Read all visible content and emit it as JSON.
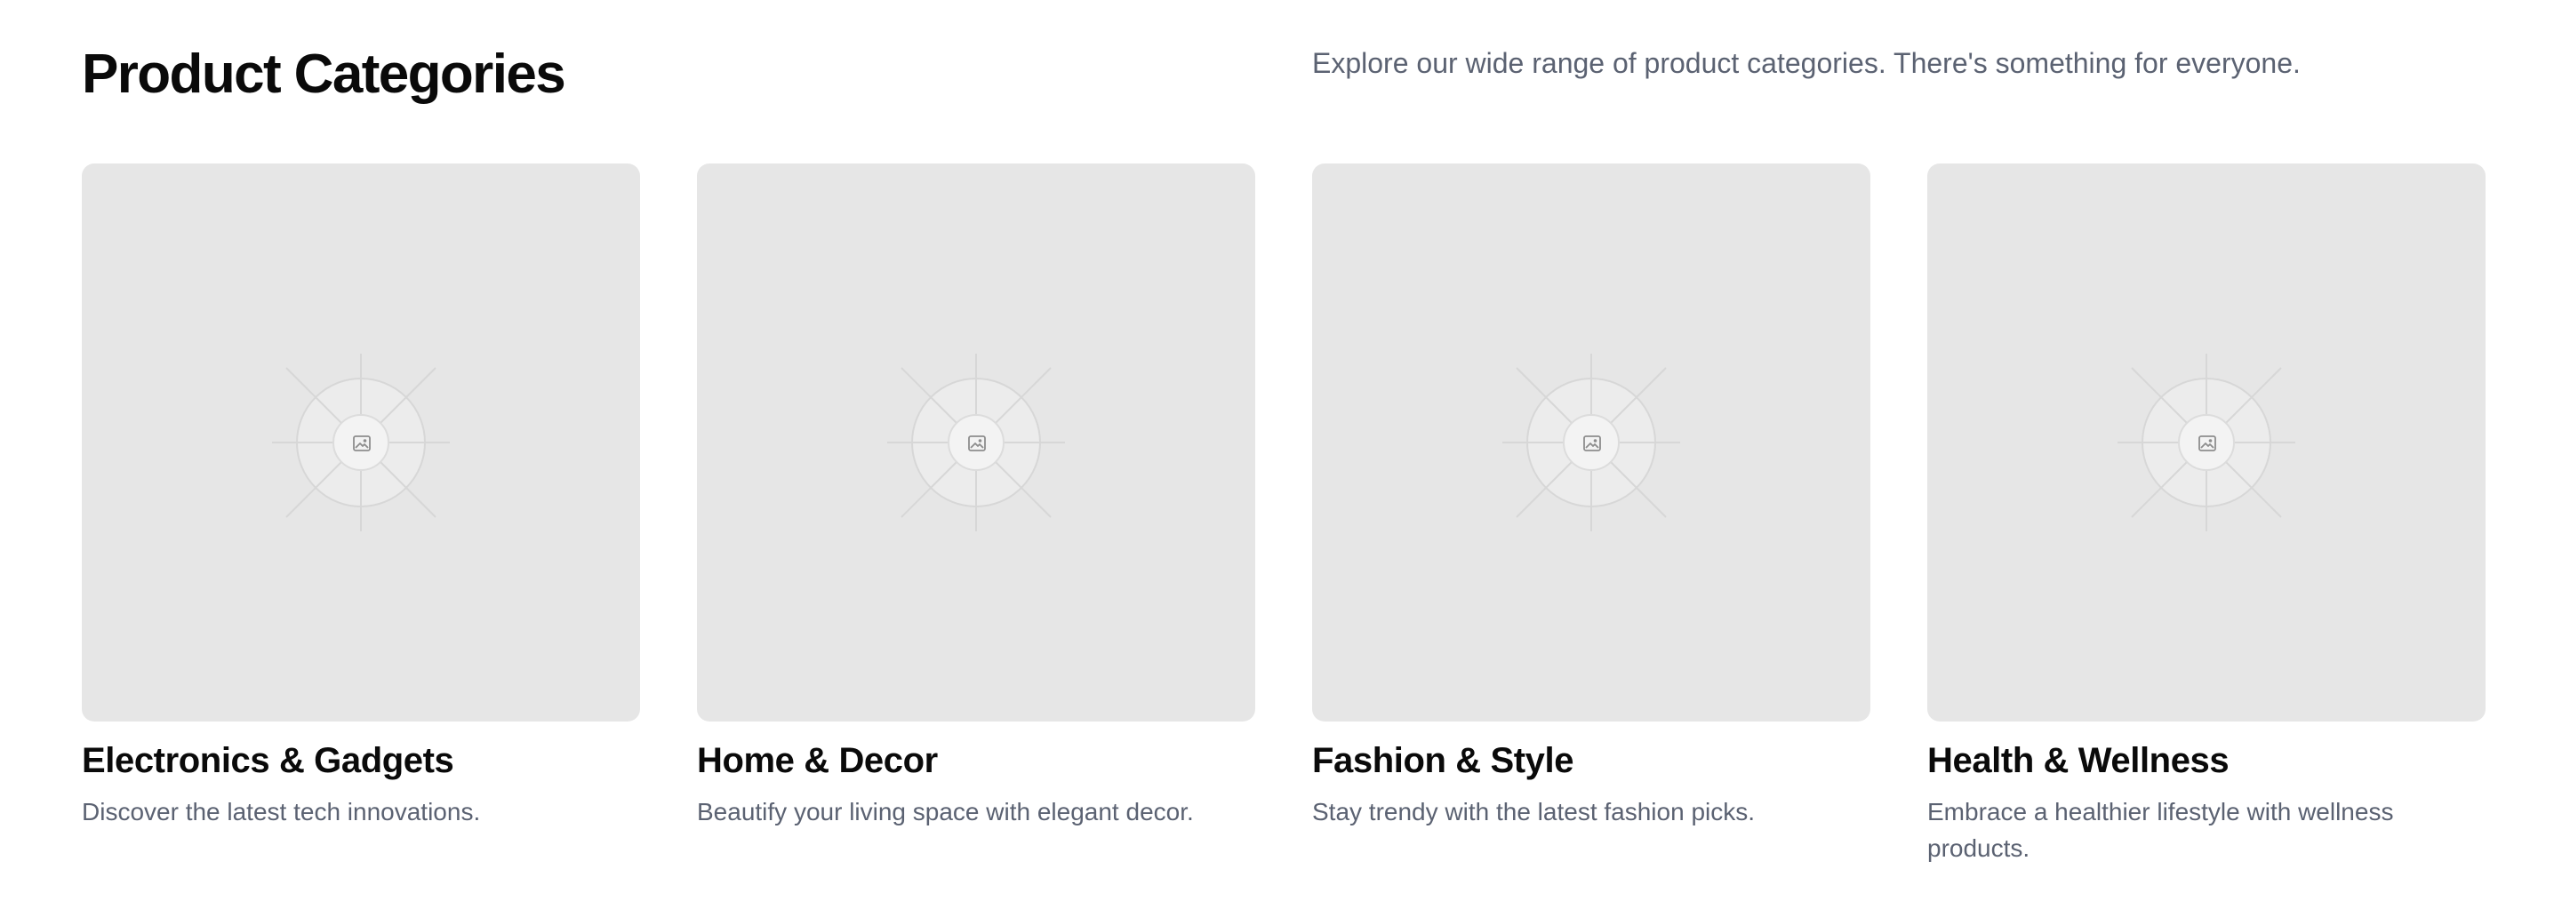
{
  "header": {
    "title": "Product Categories",
    "description": "Explore our wide range of product categories. There's something for everyone."
  },
  "categories": [
    {
      "title": "Electronics & Gadgets",
      "description": "Discover the latest tech innovations.",
      "image_icon": "image-icon"
    },
    {
      "title": "Home & Decor",
      "description": "Beautify your living space with elegant decor.",
      "image_icon": "image-icon"
    },
    {
      "title": "Fashion & Style",
      "description": "Stay trendy with the latest fashion picks.",
      "image_icon": "image-icon"
    },
    {
      "title": "Health & Wellness",
      "description": "Embrace a healthier lifestyle with wellness products.",
      "image_icon": "image-icon"
    }
  ],
  "colors": {
    "background": "#ffffff",
    "title_text": "#0a0a0a",
    "muted_text": "#5b6272",
    "image_placeholder": "#e6e6e6"
  }
}
